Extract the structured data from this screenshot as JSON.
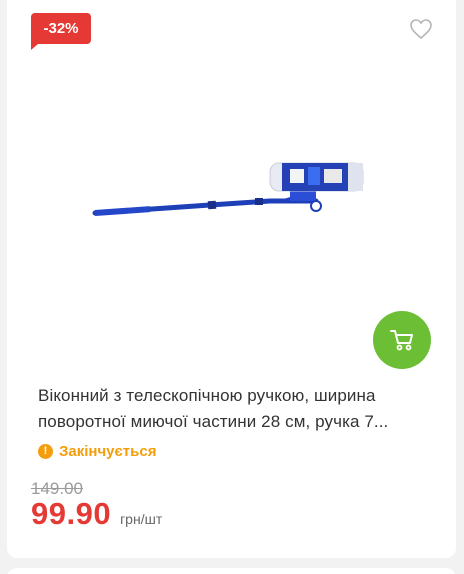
{
  "product": {
    "discount_badge": "-32%",
    "title": "Віконний з телескопічною ручкою, ширина поворотної миючої частини 28 см, ручка 7...",
    "status": "Закінчується",
    "old_price": "149.00",
    "price": "99.90",
    "unit": "грн/шт"
  },
  "icons": {
    "favorite": "heart-icon",
    "cart": "cart-icon",
    "status": "exclamation-icon"
  },
  "colors": {
    "discount": "#e53935",
    "cart_button": "#6cbf35",
    "status": "#f59e0b",
    "price": "#e53935"
  }
}
